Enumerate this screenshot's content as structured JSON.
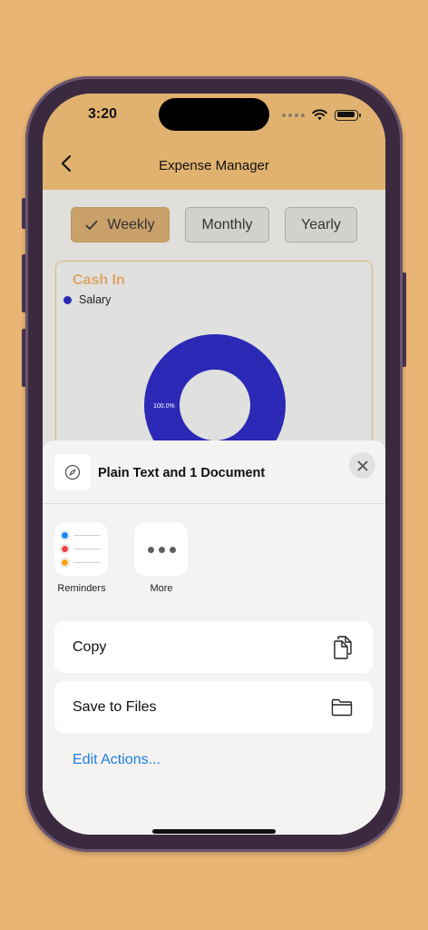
{
  "status_bar": {
    "time": "3:20"
  },
  "nav": {
    "title": "Expense Manager"
  },
  "period_tabs": [
    {
      "label": "Weekly",
      "selected": true
    },
    {
      "label": "Monthly",
      "selected": false
    },
    {
      "label": "Yearly",
      "selected": false
    }
  ],
  "chart_card": {
    "title": "Cash In",
    "legend": [
      {
        "label": "Salary",
        "color": "#2B29B5"
      }
    ],
    "slice_label": "100.0%"
  },
  "chart_data": {
    "type": "pie",
    "title": "Cash In",
    "categories": [
      "Salary"
    ],
    "values": [
      100.0
    ],
    "colors": [
      "#2B29B5"
    ],
    "donut": true
  },
  "share_sheet": {
    "title": "Plain Text and 1 Document",
    "apps": [
      {
        "label": "Reminders",
        "icon": "reminders-icon"
      },
      {
        "label": "More",
        "icon": "more-icon"
      }
    ],
    "actions": [
      {
        "label": "Copy",
        "icon": "copy-icon"
      },
      {
        "label": "Save to Files",
        "icon": "folder-icon"
      }
    ],
    "edit_actions_label": "Edit Actions..."
  },
  "colors": {
    "background": "#E9B574",
    "header": "#E1B26F",
    "accent_tab": "#C9A06A",
    "chart_title": "#DDA66A",
    "link": "#1D7FE1"
  }
}
